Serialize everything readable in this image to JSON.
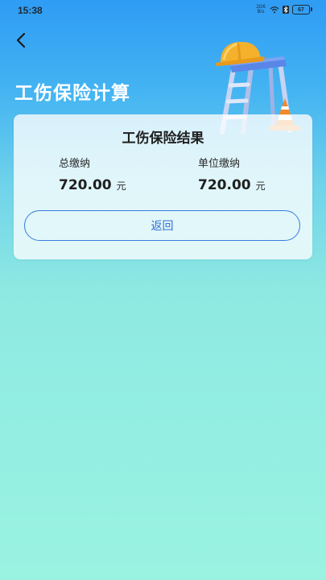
{
  "status_bar": {
    "time": "15:38",
    "network_label": "2G6",
    "network_speed": "B/s",
    "battery": "67"
  },
  "header": {
    "title": "工伤保险计算"
  },
  "result": {
    "title": "工伤保险结果",
    "total": {
      "label": "总缴纳",
      "value": "720.00",
      "unit": "元"
    },
    "employer": {
      "label": "单位缴纳",
      "value": "720.00",
      "unit": "元"
    },
    "return_label": "返回"
  },
  "colors": {
    "accent": "#3270d6",
    "background_top": "#2f9cf5",
    "background_bottom": "#9af3e1"
  },
  "icons": {
    "back": "chevron-left-icon",
    "illustration": "hardhat-ladder-cone-illustration"
  }
}
